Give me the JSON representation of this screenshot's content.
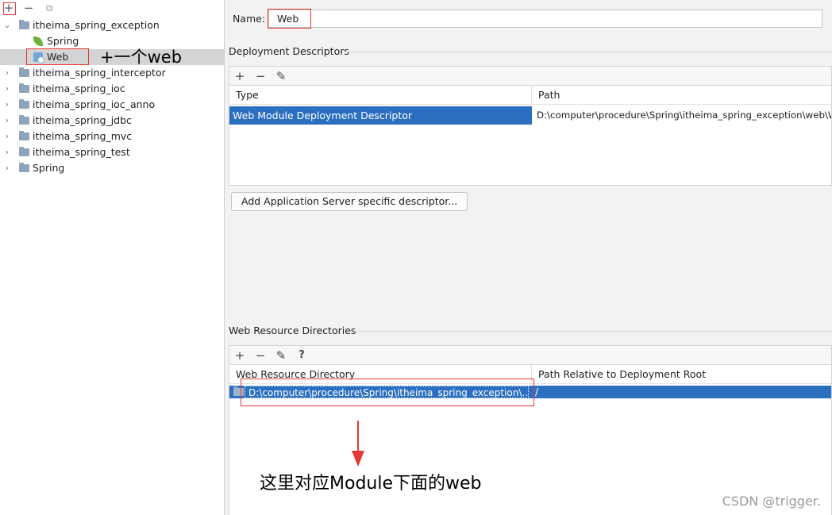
{
  "left_toolbar": {
    "add_icon": "+",
    "remove_icon": "−",
    "copy_icon": "⧉"
  },
  "tree": [
    {
      "label": "itheima_spring_exception",
      "type": "module",
      "expanded": true
    },
    {
      "label": "Spring",
      "type": "spring-facet"
    },
    {
      "label": "Web",
      "type": "web-facet",
      "selected": true
    },
    {
      "label": "itheima_spring_interceptor",
      "type": "module"
    },
    {
      "label": "itheima_spring_ioc",
      "type": "module"
    },
    {
      "label": "itheima_spring_ioc_anno",
      "type": "module"
    },
    {
      "label": "itheima_spring_jdbc",
      "type": "module"
    },
    {
      "label": "itheima_spring_mvc",
      "type": "module"
    },
    {
      "label": "itheima_spring_test",
      "type": "module"
    },
    {
      "label": "Spring",
      "type": "module"
    }
  ],
  "name_field": {
    "label": "Name:",
    "value": "Web"
  },
  "deployment_descriptors": {
    "title": "Deployment Descriptors",
    "toolbar": {
      "add": "+",
      "remove": "−",
      "edit": "✎"
    },
    "columns": [
      "Type",
      "Path"
    ],
    "rows": [
      {
        "type": "Web Module Deployment Descriptor",
        "path": "D:\\computer\\procedure\\Spring\\itheima_spring_exception\\web\\WEB-INF\\web.xml"
      }
    ],
    "add_button": "Add Application Server specific descriptor..."
  },
  "web_resource_directories": {
    "title": "Web Resource Directories",
    "toolbar": {
      "add": "+",
      "remove": "−",
      "edit": "✎",
      "help": "?"
    },
    "columns": [
      "Web Resource Directory",
      "Path Relative to Deployment Root"
    ],
    "rows": [
      {
        "directory": "D:\\computer\\procedure\\Spring\\itheima_spring_exception\\...",
        "relative": "/"
      }
    ]
  },
  "annotations": {
    "add_web": "+一个web",
    "module_web": "这里对应Module下面的web"
  },
  "watermark": "CSDN @trigger.",
  "colors": {
    "selection": "#2b6fc1",
    "annotation_red": "#e53935",
    "tree_selected": "#d4d4d4"
  }
}
